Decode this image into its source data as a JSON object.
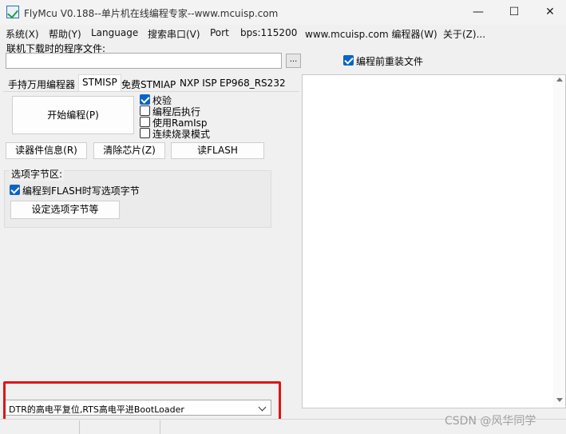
{
  "window": {
    "title": "FlyMcu V0.188--单片机在线编程专家--www.mcuisp.com",
    "minimize": "—",
    "maximize": "☐",
    "close": "✕"
  },
  "menu": {
    "items": [
      "系统(X)",
      "帮助(Y)",
      "Language",
      "搜索串口(V)",
      "Port",
      "bps:115200",
      "www.mcuisp.com 编程器(W)",
      "关于(Z)..."
    ]
  },
  "file": {
    "label": "联机下载时的程序文件:",
    "value": "",
    "browse_label": "...",
    "reload_label": "编程前重装文件",
    "reload_checked": true
  },
  "tabs": {
    "items": [
      "手持万用编程器",
      "STMISP",
      "免费STMIAP",
      "NXP ISP",
      "EP968_RS232"
    ],
    "active": "STMISP"
  },
  "stmisp": {
    "start_button": "开始编程(P)",
    "options": [
      {
        "label": "校验",
        "checked": true
      },
      {
        "label": "编程后执行",
        "checked": false
      },
      {
        "label": "使用RamIsp",
        "checked": false
      },
      {
        "label": "连续烧录模式",
        "checked": false
      }
    ],
    "read_info_button": "读器件信息(R)",
    "erase_button": "清除芯片(Z)",
    "read_flash_button": "读FLASH",
    "option_group": {
      "title": "选项字节区:",
      "write_option_label": "编程到FLASH时写选项字节",
      "write_option_checked": true,
      "set_button": "设定选项字节等"
    }
  },
  "dropdown": {
    "selected": "DTR的高电平复位,RTS高电平进BootLoader"
  },
  "watermark": "CSDN @风华同学"
}
